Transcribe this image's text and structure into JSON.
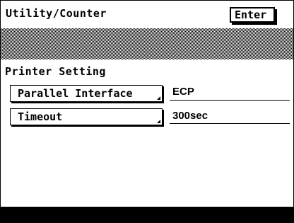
{
  "header": {
    "title": "Utility/Counter",
    "enter_label": "Enter"
  },
  "section": {
    "heading": "Printer Setting"
  },
  "settings": [
    {
      "label": "Parallel Interface",
      "value": "ECP"
    },
    {
      "label": "Timeout",
      "value": "300sec"
    }
  ],
  "colors": {
    "foreground": "#000000",
    "background": "#ffffff"
  }
}
